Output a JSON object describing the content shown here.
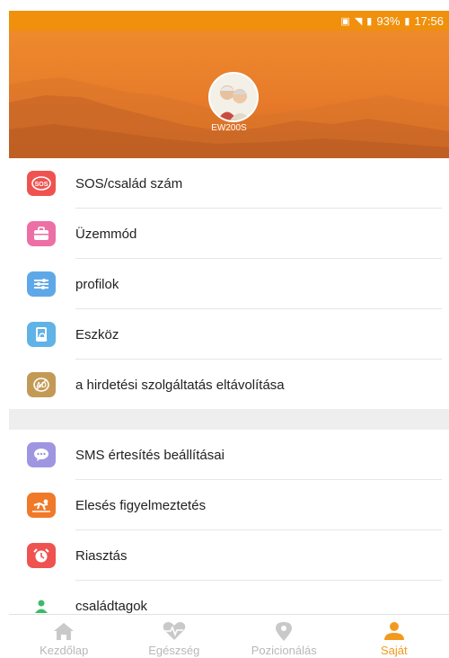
{
  "colors": {
    "accent": "#f29a1e",
    "statusbar": "#f0900c",
    "inactive_tab": "#b8b8b8"
  },
  "status_bar": {
    "battery": "93%",
    "time": "17:56"
  },
  "profile": {
    "device_name": "EW200S"
  },
  "section1": [
    {
      "id": "sos",
      "label": "SOS/család szám",
      "icon": "sos-icon",
      "color": "#ef5350"
    },
    {
      "id": "mode",
      "label": "Üzemmód",
      "icon": "briefcase-icon",
      "color": "#ec6fa6"
    },
    {
      "id": "profiles",
      "label": "profilok",
      "icon": "sliders-icon",
      "color": "#5fa8e8"
    },
    {
      "id": "device",
      "label": "Eszköz",
      "icon": "device-icon",
      "color": "#5fb3e6"
    },
    {
      "id": "ads",
      "label": "a hirdetési szolgáltatás eltávolítása",
      "icon": "no-ads-icon",
      "color": "#c39a55"
    }
  ],
  "section2": [
    {
      "id": "sms",
      "label": "SMS értesítés beállításai",
      "icon": "chat-icon",
      "color": "#9e96e0"
    },
    {
      "id": "fall",
      "label": "Elesés figyelmeztetés",
      "icon": "fall-icon",
      "color": "#f07a2a"
    },
    {
      "id": "alarm",
      "label": "Riasztás",
      "icon": "alarm-icon",
      "color": "#ef5350"
    },
    {
      "id": "family",
      "label": "családtagok",
      "icon": "person-icon",
      "color": "#3cba6a"
    }
  ],
  "tabs": [
    {
      "label": "Kezdőlap",
      "icon": "home-icon",
      "active": false
    },
    {
      "label": "Egészség",
      "icon": "heart-pulse-icon",
      "active": false
    },
    {
      "label": "Pozicionálás",
      "icon": "location-pin-icon",
      "active": false
    },
    {
      "label": "Saját",
      "icon": "user-icon",
      "active": true
    }
  ]
}
